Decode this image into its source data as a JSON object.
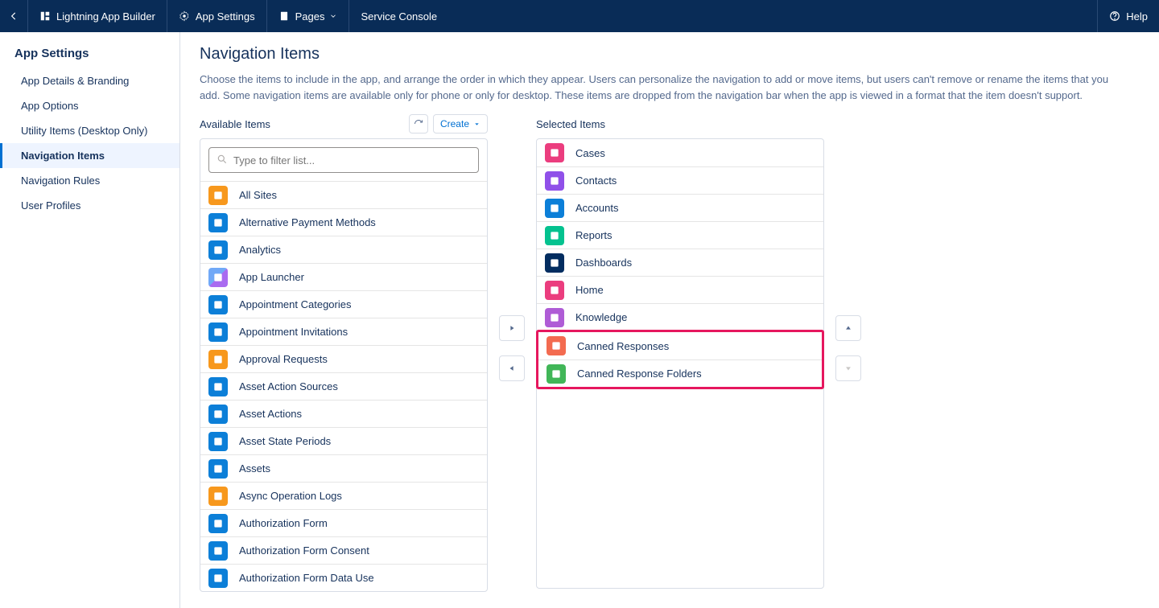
{
  "topbar": {
    "app_builder": "Lightning App Builder",
    "app_settings": "App Settings",
    "pages": "Pages",
    "console": "Service Console",
    "help": "Help"
  },
  "sidebar": {
    "title": "App Settings",
    "items": [
      {
        "label": "App Details & Branding"
      },
      {
        "label": "App Options"
      },
      {
        "label": "Utility Items (Desktop Only)"
      },
      {
        "label": "Navigation Items"
      },
      {
        "label": "Navigation Rules"
      },
      {
        "label": "User Profiles"
      }
    ]
  },
  "page": {
    "title": "Navigation Items",
    "description": "Choose the items to include in the app, and arrange the order in which they appear. Users can personalize the navigation to add or move items, but users can't remove or rename the items that you add. Some navigation items are available only for phone or only for desktop. These items are dropped from the navigation bar when the app is viewed in a format that the item doesn't support."
  },
  "available": {
    "title": "Available Items",
    "create": "Create",
    "filter_placeholder": "Type to filter list...",
    "items": [
      {
        "label": "All Sites",
        "color": "ic-orange"
      },
      {
        "label": "Alternative Payment Methods",
        "color": "ic-blue"
      },
      {
        "label": "Analytics",
        "color": "ic-blue"
      },
      {
        "label": "App Launcher",
        "color": "ic-multicolor"
      },
      {
        "label": "Appointment Categories",
        "color": "ic-blue"
      },
      {
        "label": "Appointment Invitations",
        "color": "ic-blue"
      },
      {
        "label": "Approval Requests",
        "color": "ic-orange"
      },
      {
        "label": "Asset Action Sources",
        "color": "ic-blue"
      },
      {
        "label": "Asset Actions",
        "color": "ic-blue"
      },
      {
        "label": "Asset State Periods",
        "color": "ic-blue"
      },
      {
        "label": "Assets",
        "color": "ic-blue"
      },
      {
        "label": "Async Operation Logs",
        "color": "ic-orange"
      },
      {
        "label": "Authorization Form",
        "color": "ic-blue"
      },
      {
        "label": "Authorization Form Consent",
        "color": "ic-blue"
      },
      {
        "label": "Authorization Form Data Use",
        "color": "ic-blue"
      }
    ]
  },
  "selected": {
    "title": "Selected Items",
    "items": [
      {
        "label": "Cases",
        "color": "ic-pink"
      },
      {
        "label": "Contacts",
        "color": "ic-purple"
      },
      {
        "label": "Accounts",
        "color": "ic-blue"
      },
      {
        "label": "Reports",
        "color": "ic-teal"
      },
      {
        "label": "Dashboards",
        "color": "ic-navy"
      },
      {
        "label": "Home",
        "color": "ic-pink"
      },
      {
        "label": "Knowledge",
        "color": "ic-violet"
      },
      {
        "label": "Canned Responses",
        "color": "ic-coral"
      },
      {
        "label": "Canned Response Folders",
        "color": "ic-green"
      }
    ]
  }
}
